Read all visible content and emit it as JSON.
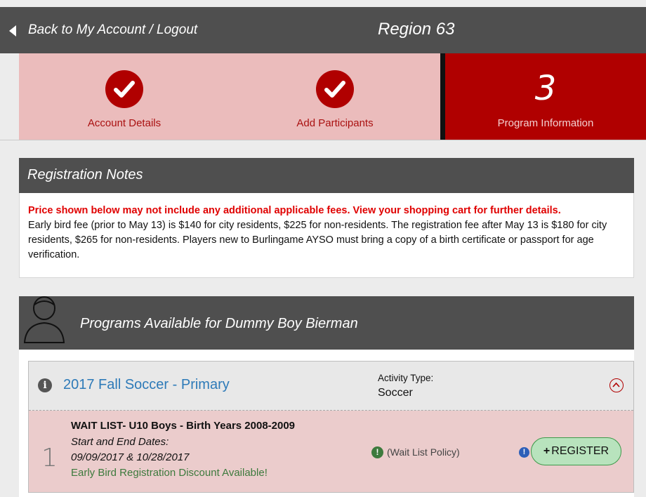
{
  "header": {
    "back_link": "Back to My Account",
    "separator": "/",
    "logout_link": "Logout",
    "region_title": "Region 63"
  },
  "steps": [
    {
      "label": "Account Details",
      "status": "complete"
    },
    {
      "label": "Add Participants",
      "status": "complete"
    },
    {
      "label": "Program Information",
      "number": "3",
      "status": "current"
    }
  ],
  "notes": {
    "title": "Registration Notes",
    "warning": "Price shown below may not include any additional applicable fees. View your shopping cart for further details.",
    "body": "Early bird fee (prior to May 13) is $140 for city residents, $225 for non-residents. The registration fee after May 13 is $180 for city residents, $265 for non-residents. Players new to Burlingame AYSO must bring a copy of a birth certificate or passport for age verification."
  },
  "programs": {
    "title": "Programs Available for Dummy Boy Bierman",
    "items": [
      {
        "name": "2017 Fall Soccer - Primary",
        "activity_type_label": "Activity Type:",
        "activity_type": "Soccer",
        "divisions": [
          {
            "number": "1",
            "title": "WAIT LIST- U10 Boys - Birth Years 2008-2009",
            "dates_label": "Start and End Dates:",
            "dates": "09/09/2017 & 10/28/2017",
            "discount": "Early Bird Registration Discount Available!",
            "wait_policy": "(Wait List Policy)",
            "register_label": "REGISTER"
          }
        ]
      }
    ]
  },
  "colors": {
    "header_bg": "#4f4f4f",
    "brand_red": "#b00000",
    "step_complete_bg": "#ebbcbc",
    "link_blue": "#2d7ab8",
    "success_green": "#3d7a3d",
    "register_bg": "#b8e3bd"
  }
}
